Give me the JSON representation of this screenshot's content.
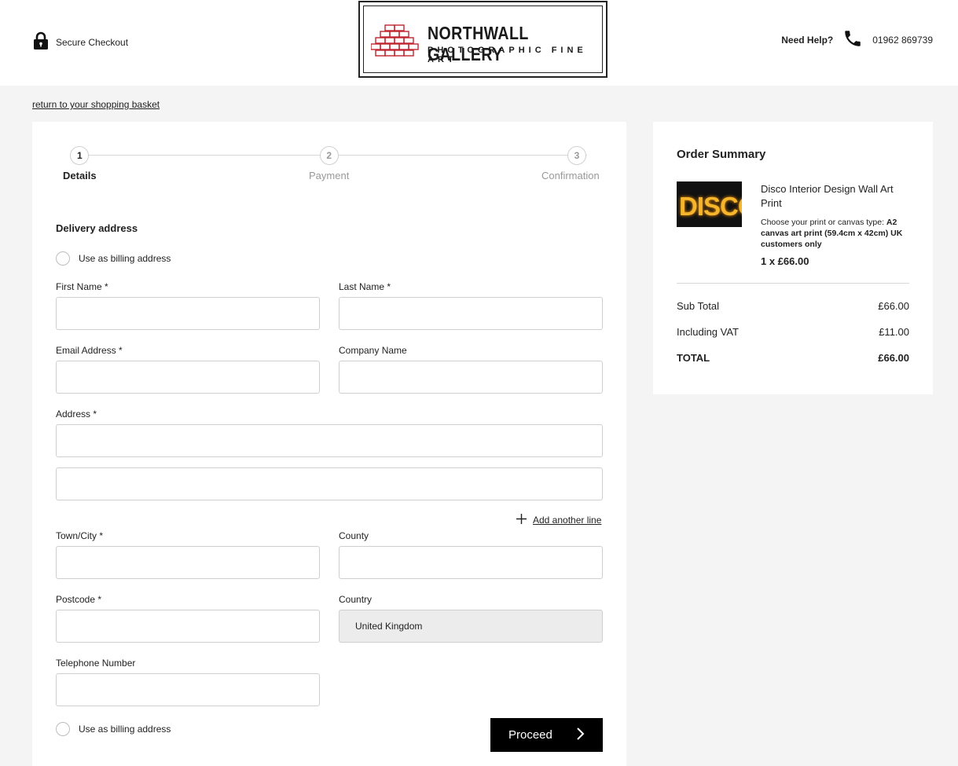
{
  "header": {
    "secure_label": "Secure Checkout",
    "logo_title": "NORTHWALL GALLERY",
    "logo_subtitle": "PHOTOGRAPHIC FINE ART",
    "help_label": "Need Help?",
    "phone": "01962 869739"
  },
  "return_link": "return to your shopping basket",
  "steps": [
    {
      "number": "1",
      "label": "Details",
      "state": "active"
    },
    {
      "number": "2",
      "label": "Payment",
      "state": "inactive"
    },
    {
      "number": "3",
      "label": "Confirmation",
      "state": "inactive"
    }
  ],
  "form": {
    "section_title": "Delivery address",
    "billing_label_top": "Use as billing address",
    "billing_label_bottom": "Use as billing address",
    "first_name_label": "First Name *",
    "last_name_label": "Last Name *",
    "email_label": "Email Address *",
    "company_label": "Company Name",
    "address_label": "Address *",
    "add_line_label": "Add another line",
    "town_label": "Town/City *",
    "county_label": "County",
    "postcode_label": "Postcode *",
    "country_label": "Country",
    "country_value": "United Kingdom",
    "telephone_label": "Telephone Number",
    "proceed_label": "Proceed"
  },
  "summary": {
    "title": "Order Summary",
    "thumb_text": "DISCO",
    "product_name": "Disco Interior Design Wall Art Print",
    "option_prefix": "Choose your print or canvas type:",
    "option_value": "A2 canvas art print (59.4cm x 42cm) UK customers only",
    "quantity_price": "1 x £66.00",
    "subtotal_label": "Sub Total",
    "subtotal_value": "£66.00",
    "vat_label": "Including VAT",
    "vat_value": "£11.00",
    "total_label": "TOTAL",
    "total_value": "£66.00"
  }
}
